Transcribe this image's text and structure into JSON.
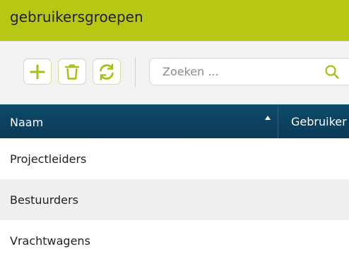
{
  "header": {
    "title": "gebruikersgroepen",
    "accent_color": "#b6c813"
  },
  "toolbar": {
    "buttons": [
      {
        "name": "add",
        "icon": "plus-icon"
      },
      {
        "name": "delete",
        "icon": "trash-icon"
      },
      {
        "name": "refresh",
        "icon": "refresh-icon"
      }
    ],
    "icon_color": "#a7bf10",
    "search": {
      "placeholder": "Zoeken ...",
      "value": "",
      "icon": "search-icon"
    }
  },
  "table": {
    "header_color": "#0d4463",
    "columns": [
      {
        "label": "Naam",
        "sort": "ascending"
      },
      {
        "label": "Gebruiker"
      }
    ],
    "rows": [
      {
        "naam": "Projectleiders"
      },
      {
        "naam": "Bestuurders"
      },
      {
        "naam": "Vrachtwagens"
      }
    ]
  }
}
